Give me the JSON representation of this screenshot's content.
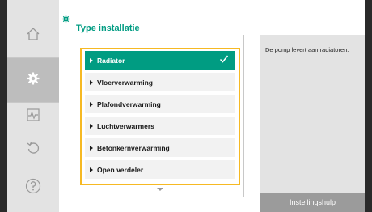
{
  "page": {
    "title": "Type installatie"
  },
  "sidebar": {
    "items": [
      {
        "icon": "home-icon",
        "active": false
      },
      {
        "icon": "gear-icon",
        "active": true
      },
      {
        "icon": "diagnostics-icon",
        "active": false
      },
      {
        "icon": "restore-icon",
        "active": false
      },
      {
        "icon": "help-icon",
        "active": false
      }
    ]
  },
  "list": {
    "items": [
      {
        "label": "Radiator",
        "selected": true
      },
      {
        "label": "Vloerverwarming",
        "selected": false
      },
      {
        "label": "Plafondverwarming",
        "selected": false
      },
      {
        "label": "Luchtverwarmers",
        "selected": false
      },
      {
        "label": "Betonkernverwarming",
        "selected": false
      },
      {
        "label": "Open verdeler",
        "selected": false
      }
    ],
    "check_icon": "checkmark-icon"
  },
  "info": {
    "text": "De pomp levert aan radiatoren."
  },
  "help_button": {
    "label": "Instellingshulp"
  },
  "colors": {
    "accent": "#009c82",
    "focus": "#f6b923",
    "sidebar": "#e3e3e3",
    "sidebar_active": "#bdbdbd"
  }
}
